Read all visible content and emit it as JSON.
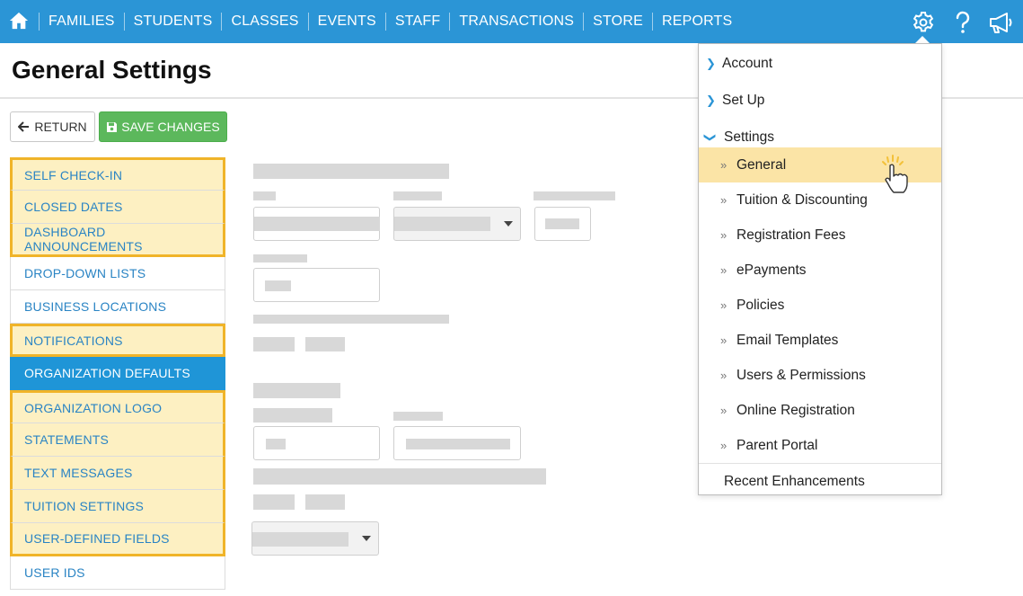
{
  "nav": {
    "items": [
      "FAMILIES",
      "STUDENTS",
      "CLASSES",
      "EVENTS",
      "STAFF",
      "TRANSACTIONS",
      "STORE",
      "REPORTS"
    ],
    "icons": [
      "home-icon",
      "gear-icon",
      "help-icon",
      "megaphone-icon"
    ],
    "bg_color": "#2b95d6"
  },
  "page": {
    "title": "General Settings"
  },
  "buttons": {
    "return_label": "RETURN",
    "save_label": "SAVE CHANGES"
  },
  "sidebar": {
    "items": [
      "SELF CHECK-IN",
      "CLOSED DATES",
      "DASHBOARD ANNOUNCEMENTS",
      "DROP-DOWN LISTS",
      "BUSINESS LOCATIONS",
      "NOTIFICATIONS",
      "ORGANIZATION DEFAULTS",
      "ORGANIZATION LOGO",
      "STATEMENTS",
      "TEXT MESSAGES",
      "TUITION SETTINGS",
      "USER-DEFINED FIELDS",
      "USER IDS"
    ],
    "active": "ORGANIZATION DEFAULTS",
    "highlight_color": "#f0b429"
  },
  "menu": {
    "top": [
      "Account",
      "Set Up",
      "Settings"
    ],
    "settings_items": [
      "General",
      "Tuition & Discounting",
      "Registration Fees",
      "ePayments",
      "Policies",
      "Email Templates",
      "Users & Permissions",
      "Online Registration",
      "Parent Portal"
    ],
    "selected": "General",
    "footer": "Recent Enhancements"
  }
}
